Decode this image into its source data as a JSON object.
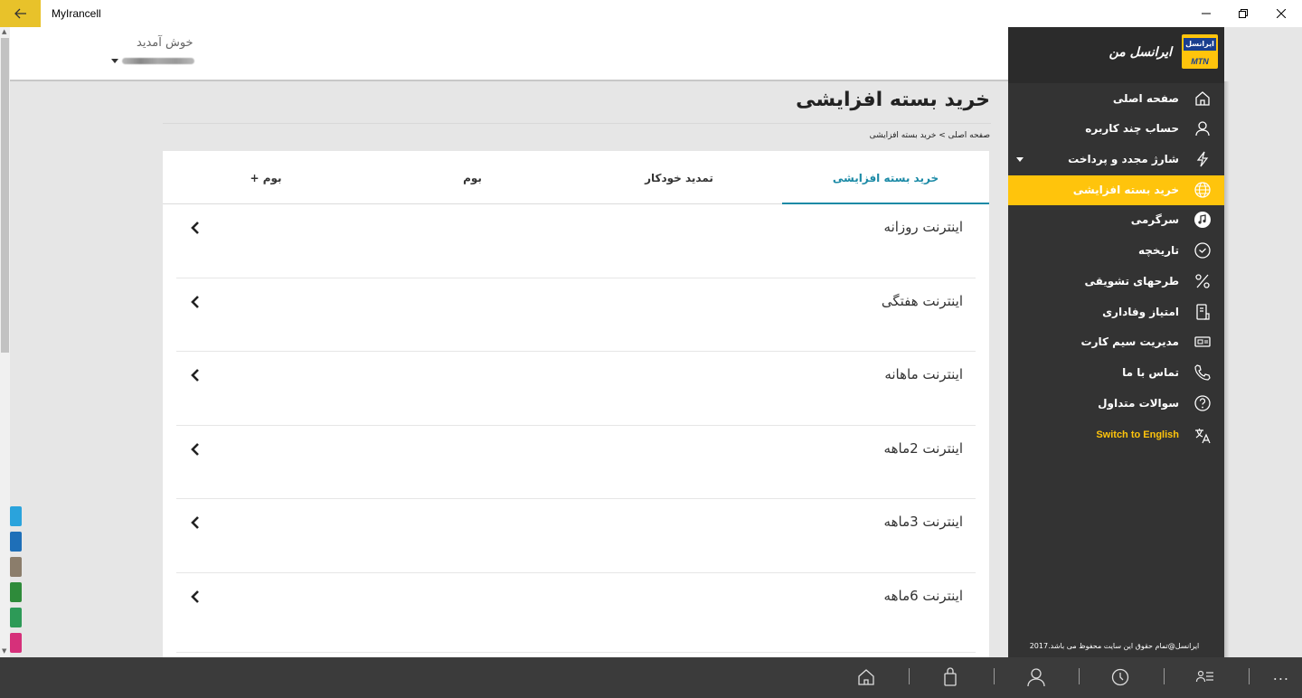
{
  "window": {
    "title": "MyIrancell",
    "back_icon": "arrow-left-icon",
    "controls": [
      "minimize-icon",
      "restore-icon",
      "close-icon"
    ]
  },
  "header": {
    "welcome": "خوش آمدید",
    "user_dropdown_icon": "caret-down-icon"
  },
  "page": {
    "title": "خرید بسته افزایشی",
    "breadcrumb": "صفحه اصلی > خرید بسته افزایشی"
  },
  "tabs": [
    {
      "label": "خرید بسته افزایشی",
      "active": true
    },
    {
      "label": "تمدید خودکار",
      "active": false
    },
    {
      "label": "بوم",
      "active": false
    },
    {
      "label": "بوم +",
      "active": false
    }
  ],
  "packages": [
    {
      "label": "اینترنت روزانه"
    },
    {
      "label": "اینترنت هفتگی"
    },
    {
      "label": "اینترنت ماهانه"
    },
    {
      "label": "اینترنت 2ماهه"
    },
    {
      "label": "اینترنت 3ماهه"
    },
    {
      "label": "اینترنت 6ماهه"
    }
  ],
  "sidebar": {
    "title": "ایرانسل من",
    "logo": {
      "top": "ایرانسل",
      "bottom": "MTN"
    },
    "items": [
      {
        "label": "صفحه اصلی",
        "icon": "home-icon"
      },
      {
        "label": "حساب چند کاربره",
        "icon": "user-icon"
      },
      {
        "label": "شارژ مجدد و پرداخت",
        "icon": "lightning-icon",
        "expandable": true
      },
      {
        "label": "خرید بسته افزایشی",
        "icon": "globe-icon",
        "active": true
      },
      {
        "label": "سرگرمی",
        "icon": "music-icon"
      },
      {
        "label": "تاریخچه",
        "icon": "clock-icon"
      },
      {
        "label": "طرحهای تشویقی",
        "icon": "percent-icon"
      },
      {
        "label": "امتیاز وفاداری",
        "icon": "loyalty-icon"
      },
      {
        "label": "مدیریت سیم کارت",
        "icon": "sim-card-icon"
      },
      {
        "label": "تماس با ما",
        "icon": "phone-icon"
      },
      {
        "label": "سوالات متداول",
        "icon": "question-icon"
      },
      {
        "label": "Switch to English",
        "icon": "translate-icon"
      }
    ],
    "footer": "ایرانسل@تمام حقوق این سایت محفوظ می باشد.2017"
  },
  "bottombar": {
    "buttons": [
      "home-icon",
      "shopping-bag-icon",
      "user-icon",
      "clock-icon",
      "list-icon"
    ],
    "more": "..."
  },
  "colors": {
    "accent": "#ffc40c",
    "tab_active": "#1b8aa6",
    "sidebar_bg": "#333333",
    "bottombar_bg": "#3b3b3b"
  }
}
